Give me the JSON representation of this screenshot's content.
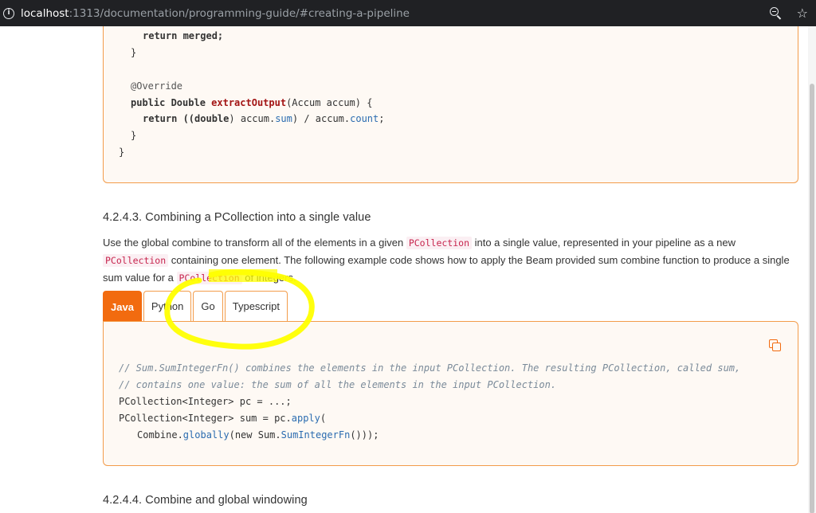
{
  "browser": {
    "url_host": "localhost",
    "url_rest": ":1313/documentation/programming-guide/#creating-a-pipeline"
  },
  "code_top": {
    "lines": [
      "return merged;",
      "}",
      "@Override",
      "public Double ",
      "extractOutput",
      "(Accum accum) {",
      "return ((",
      "double",
      ") accum.",
      "sum",
      ") / accum.",
      "count",
      ";",
      "}",
      "}"
    ]
  },
  "section": {
    "heading": "4.2.4.3. Combining a PCollection into a single value",
    "para_1": "Use the global combine to transform all of the elements in a given ",
    "code_1": "PCollection",
    "para_2": " into a single value, represented in your pipeline as a new ",
    "code_2": "PCollection",
    "para_3": " containing one element. The following example code shows how to apply the Beam provided sum combine function to produce a single sum value for a ",
    "code_3": "PCollection",
    "para_4": " of integers."
  },
  "tabs": [
    {
      "label": "Java",
      "active": true
    },
    {
      "label": "Python",
      "active": false
    },
    {
      "label": "Go",
      "active": false
    },
    {
      "label": "Typescript",
      "active": false
    }
  ],
  "code_bottom": {
    "comment_1": "// Sum.SumIntegerFn() combines the elements in the input PCollection. The resulting PCollection, called sum,",
    "comment_2": "// contains one value: the sum of all the elements in the input PCollection.",
    "line_3": "PCollection<Integer> pc = ...;",
    "line_4a": "PCollection<Integer> sum = pc.",
    "line_4b": "apply",
    "line_4c": "(",
    "line_5a": "Combine.",
    "line_5b": "globally",
    "line_5c": "(new Sum.",
    "line_5d": "SumIntegerFn",
    "line_5e": "()));"
  },
  "next_heading": "4.2.4.4. Combine and global windowing",
  "colors": {
    "accent": "#f26b0f",
    "code_border": "#f39c4a",
    "code_bg": "#fef9f4",
    "annotation": "#ffff00"
  }
}
